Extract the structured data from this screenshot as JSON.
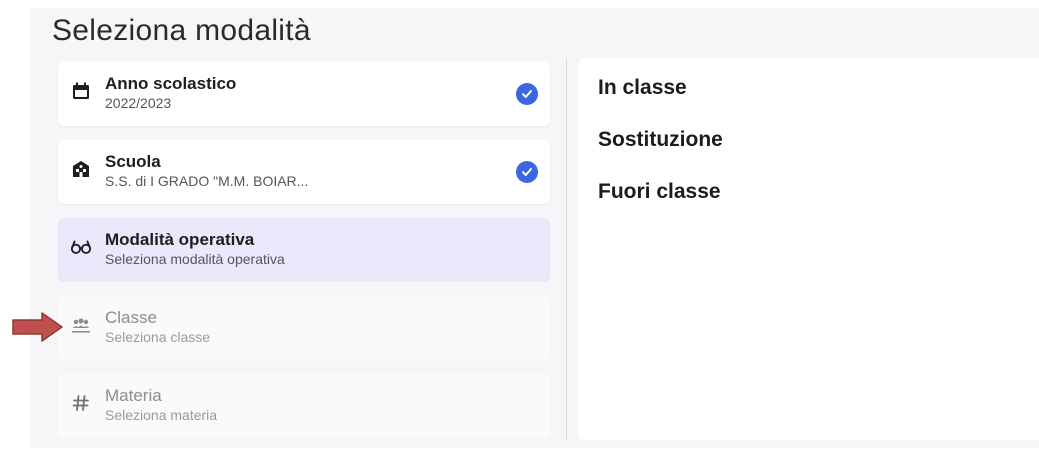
{
  "header": {
    "title": "Seleziona modalità"
  },
  "steps": [
    {
      "title": "Anno scolastico",
      "subtitle": "2022/2023",
      "icon": "calendar-icon",
      "completed": true
    },
    {
      "title": "Scuola",
      "subtitle": "S.S. di I GRADO \"M.M. BOIAR...",
      "icon": "school-icon",
      "completed": true
    },
    {
      "title": "Modalità operativa",
      "subtitle": "Seleziona modalità operativa",
      "icon": "glasses-icon",
      "active": true
    },
    {
      "title": "Classe",
      "subtitle": "Seleziona classe",
      "icon": "group-icon",
      "disabled": true
    },
    {
      "title": "Materia",
      "subtitle": "Seleziona materia",
      "icon": "hash-icon",
      "disabled": true
    }
  ],
  "options": [
    {
      "label": "In classe"
    },
    {
      "label": "Sostituzione"
    },
    {
      "label": "Fuori classe"
    }
  ],
  "colors": {
    "accent": "#3a66e0",
    "active_bg": "#e9e9fb",
    "arrow": "#c0504d"
  }
}
